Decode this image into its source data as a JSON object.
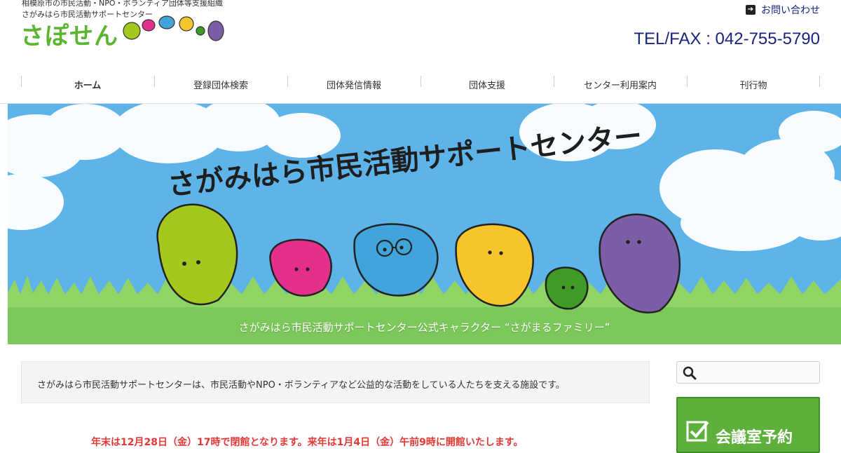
{
  "header": {
    "tagline": "相模原市の市民活動・NPO・ボランティア団体等支援組織",
    "subname": "さがみはら市民活動サポートセンター",
    "logo": "さぽせん",
    "contact_label": "お問い合わせ",
    "telfax": "TEL/FAX : 042-755-5790"
  },
  "nav": {
    "items": [
      {
        "label": "ホーム"
      },
      {
        "label": "登録団体検索"
      },
      {
        "label": "団体発信情報"
      },
      {
        "label": "団体支援"
      },
      {
        "label": "センター利用案内"
      },
      {
        "label": "刊行物"
      }
    ]
  },
  "hero": {
    "title": "さがみはら市民活動サポートセンター",
    "caption": "さがみはら市民活動サポートセンター公式キャラクター “さがまるファミリー”",
    "colors": {
      "sky": "#5eb4e8",
      "grass": "#7cc85a",
      "lime": "#a5c81e",
      "pink": "#e3318b",
      "blue": "#41a5dc",
      "yellow": "#f5c52b",
      "green": "#3f9a26",
      "purple": "#7b5ea7"
    }
  },
  "intro": {
    "text": "さがみはら市民活動サポートセンターは、市民活動やNPO・ボランティアなど公益的な活動をしている人たちを支える施設です。"
  },
  "notice": {
    "text": "年末は12月28日（金）17時で閉館となります。来年は1月4日（金）午前9時に開館いたします。"
  },
  "sidebar": {
    "search_placeholder": "",
    "reserve_label": "会議室予約"
  },
  "icons": {
    "contact": "arrow-right-icon",
    "search": "search-icon",
    "reserve": "checkbox-icon"
  }
}
